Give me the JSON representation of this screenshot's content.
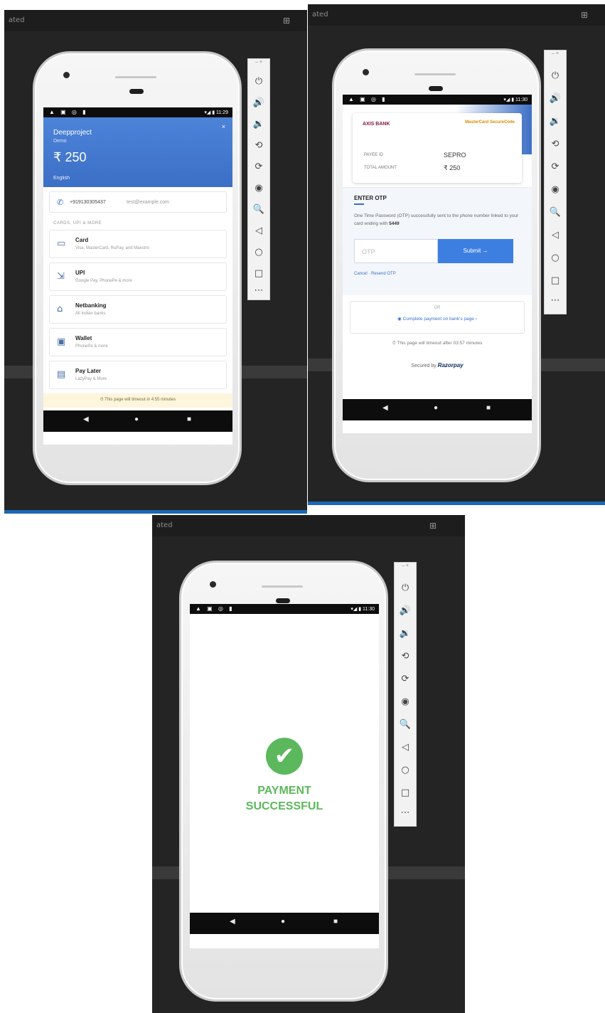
{
  "window": {
    "title": "ated"
  },
  "statusbar": {
    "icons_left": "▲ ▣ ◎ ▮",
    "icons_right": "▾◢ ▮ 11:29",
    "icons_right_2": "▾◢ ▮ 11:30"
  },
  "navbar": {
    "back": "◀",
    "home": "●",
    "recents": "■"
  },
  "toolbar": {
    "window_controls": "–  ×",
    "icons": [
      "power-icon",
      "volume-up-icon",
      "volume-down-icon",
      "rotate-left-icon",
      "rotate-right-icon",
      "camera-icon",
      "zoom-icon",
      "back-icon",
      "home-icon",
      "overview-icon",
      "more-icon"
    ],
    "glyphs": [
      "⏻",
      "🔊",
      "🔉",
      "⟲",
      "⟳",
      "◉",
      "🔍",
      "◁",
      "○",
      "□",
      "⋯"
    ]
  },
  "checkout": {
    "merchant": "Deepproject",
    "merchant_sub": "Demo",
    "amount": "₹ 250",
    "language": "English",
    "close": "×",
    "contact_phone": "+919130305437",
    "contact_email": "test@example.com",
    "section_label": "CARDS, UPI & MORE",
    "methods": [
      {
        "title": "Card",
        "sub": "Visa, MasterCard, RuPay, and Maestro",
        "icon": "card-icon",
        "glyph": "▭"
      },
      {
        "title": "UPI",
        "sub": "Google Pay, PhonePe & more",
        "icon": "upi-icon",
        "glyph": "⇲"
      },
      {
        "title": "Netbanking",
        "sub": "All Indian banks",
        "icon": "bank-icon",
        "glyph": "⌂"
      },
      {
        "title": "Wallet",
        "sub": "PhonePe & more",
        "icon": "wallet-icon",
        "glyph": "▣"
      },
      {
        "title": "Pay Later",
        "sub": "LazyPay & More",
        "icon": "paylater-icon",
        "glyph": "▤"
      }
    ],
    "timer": "⏱ This page will timeout in 4:55 minutes"
  },
  "otp": {
    "bank": "AXIS BANK",
    "card_brand": "MasterCard SecureCode",
    "payee_label": "PAYEE ID",
    "payee_value": "SEPRO",
    "amount_label": "TOTAL AMOUNT",
    "amount_value": "₹ 250",
    "heading": "ENTER OTP",
    "message": "One Time Password (OTP) successfully sent to the phone number linked to your card ending with",
    "card_ending": "5449",
    "input_placeholder": "OTP",
    "submit": "Submit →",
    "links": "Cancel  ·  Resend OTP",
    "or": "OR",
    "alt": "◉ Complete payment on bank's page ›",
    "expire": "⏱ This page will timeout after 03:57 minutes",
    "secured_prefix": "Secured by",
    "secured_brand": "Razorpay"
  },
  "success": {
    "icon": "✔",
    "line1": "PAYMENT",
    "line2": "SUCCESSFUL"
  }
}
